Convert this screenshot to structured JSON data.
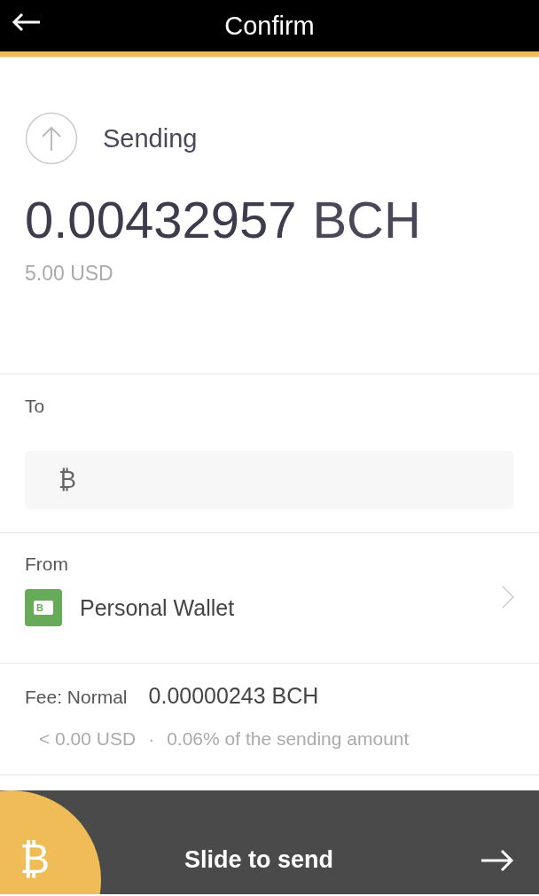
{
  "header": {
    "title": "Confirm"
  },
  "summary": {
    "label": "Sending",
    "amount": "0.00432957",
    "unit": "BCH",
    "fiat": "5.00 USD"
  },
  "to": {
    "label": "To",
    "currency_symbol": "₿"
  },
  "from": {
    "label": "From",
    "wallet": "Personal Wallet",
    "wallet_badge": "B"
  },
  "fee": {
    "label": "Fee: Normal",
    "amount": "0.00000243 BCH",
    "fiat": "< 0.00 USD",
    "separator": "·",
    "share": "0.06% of the sending amount"
  },
  "slider": {
    "handle_symbol": "₿",
    "label": "Slide to send"
  }
}
